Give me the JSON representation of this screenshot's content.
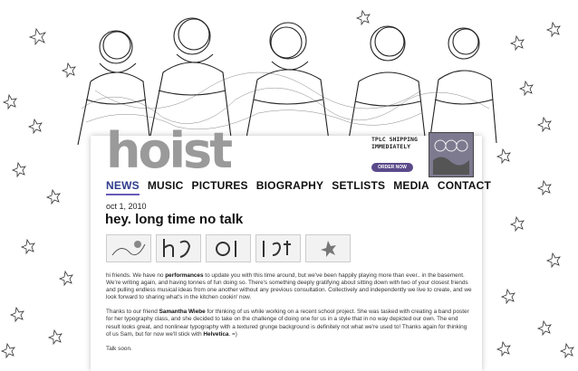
{
  "site": {
    "logo": "hoist"
  },
  "promo": {
    "text": "TPLC shipping immediately",
    "button_label": "Order now"
  },
  "nav": {
    "items": [
      "NEWS",
      "MUSIC",
      "PICTURES",
      "BIOGRAPHY",
      "SETLISTS",
      "MEDIA",
      "CONTACT"
    ],
    "active": "NEWS"
  },
  "post": {
    "date": "oct 1, 2010",
    "title": "hey. long time no talk",
    "p1_a": "hi friends. We have no ",
    "p1_b": "performances",
    "p1_c": " to update you with this time around, but we've been happily playing more than ever.. in the basement. We're writing again, and having tonnes of fun doing so. There's something deeply gratifying about sitting down with two of your closest friends and pulling endless musical ideas from one another without any previous consultation. Collectively and independently we live to create, and we look forward to sharing what's in the kitchen cookin' now.",
    "p2_a": "Thanks to our friend ",
    "p2_b": "Samantha Wiebe",
    "p2_c": " for thinking of us while working on a recent school project. She was tasked with creating a band poster for her typography class, and she decided to take on the challenge of doing one for us in a style that in no way depicted our own. The end result looks great, and nonlinear typography with a textured grunge background is definitely not what we're used to! Thanks again for thinking of us Sam, but for now we'll stick with ",
    "p2_d": "Helvetica",
    "p2_e": ". =)",
    "p3": "Talk soon."
  },
  "colors": {
    "accent": "#6b5bb8",
    "nav_active": "#2f3c8c",
    "logo": "#9a9a9a"
  }
}
